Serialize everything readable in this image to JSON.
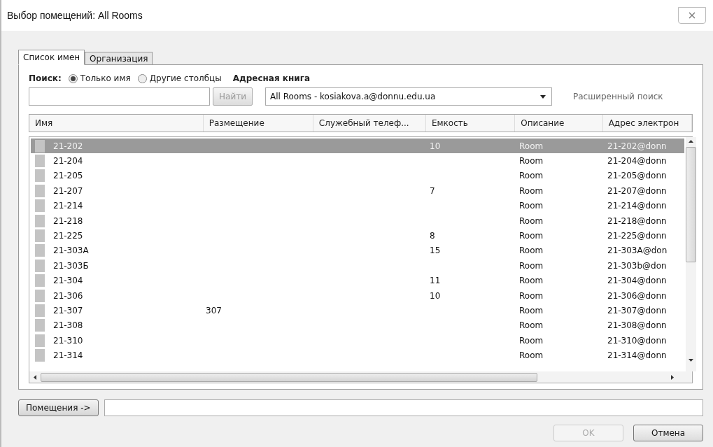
{
  "window": {
    "title": "Выбор помещений: All Rooms"
  },
  "tabs": [
    {
      "label": "Список имен",
      "selected": true
    },
    {
      "label": "Организация",
      "selected": false
    }
  ],
  "search": {
    "label": "Поиск:",
    "options": [
      {
        "label": "Только имя",
        "selected": true
      },
      {
        "label": "Другие столбцы",
        "selected": false
      }
    ],
    "find_button": {
      "label": "Найти",
      "disabled": true
    }
  },
  "address_book": {
    "label": "Адресная книга",
    "value": "All Rooms - kosiakova.a@donnu.edu.ua",
    "advanced_link": "Расширенный поиск"
  },
  "table": {
    "columns": [
      "Имя",
      "Размещение",
      "Служебный телеф...",
      "Емкость",
      "Описание",
      "Адрес электрон"
    ],
    "rows": [
      {
        "name": "21-202",
        "location": "",
        "phone": "",
        "capacity": "10",
        "description": "Room",
        "email": "21-202@donn",
        "selected": true
      },
      {
        "name": "21-204",
        "location": "",
        "phone": "",
        "capacity": "",
        "description": "Room",
        "email": "21-204@donn",
        "selected": false
      },
      {
        "name": "21-205",
        "location": "",
        "phone": "",
        "capacity": "",
        "description": "Room",
        "email": "21-205@donn",
        "selected": false
      },
      {
        "name": "21-207",
        "location": "",
        "phone": "",
        "capacity": "7",
        "description": "Room",
        "email": "21-207@donn",
        "selected": false
      },
      {
        "name": "21-214",
        "location": "",
        "phone": "",
        "capacity": "",
        "description": "Room",
        "email": "21-214@donn",
        "selected": false
      },
      {
        "name": "21-218",
        "location": "",
        "phone": "",
        "capacity": "",
        "description": "Room",
        "email": "21-218@donn",
        "selected": false
      },
      {
        "name": "21-225",
        "location": "",
        "phone": "",
        "capacity": "8",
        "description": "Room",
        "email": "21-225@donn",
        "selected": false
      },
      {
        "name": "21-303А",
        "location": "",
        "phone": "",
        "capacity": "15",
        "description": "Room",
        "email": "21-303A@don",
        "selected": false
      },
      {
        "name": "21-303Б",
        "location": "",
        "phone": "",
        "capacity": "",
        "description": "Room",
        "email": "21-303b@don",
        "selected": false
      },
      {
        "name": "21-304",
        "location": "",
        "phone": "",
        "capacity": "11",
        "description": "Room",
        "email": "21-304@donn",
        "selected": false
      },
      {
        "name": "21-306",
        "location": "",
        "phone": "",
        "capacity": "10",
        "description": "Room",
        "email": "21-306@donn",
        "selected": false
      },
      {
        "name": "21-307",
        "location": "307",
        "phone": "",
        "capacity": "",
        "description": "Room",
        "email": "21-307@donn",
        "selected": false
      },
      {
        "name": "21-308",
        "location": "",
        "phone": "",
        "capacity": "",
        "description": "Room",
        "email": "21-308@donn",
        "selected": false
      },
      {
        "name": "21-310",
        "location": "",
        "phone": "",
        "capacity": "",
        "description": "Room",
        "email": "21-310@donn",
        "selected": false
      },
      {
        "name": "21-314",
        "location": "",
        "phone": "",
        "capacity": "",
        "description": "Room",
        "email": "21-314@donn",
        "selected": false
      }
    ]
  },
  "rooms_button": "Помещения ->",
  "buttons": [
    {
      "label": "OK",
      "disabled": true
    },
    {
      "label": "Отмена",
      "disabled": false
    }
  ]
}
